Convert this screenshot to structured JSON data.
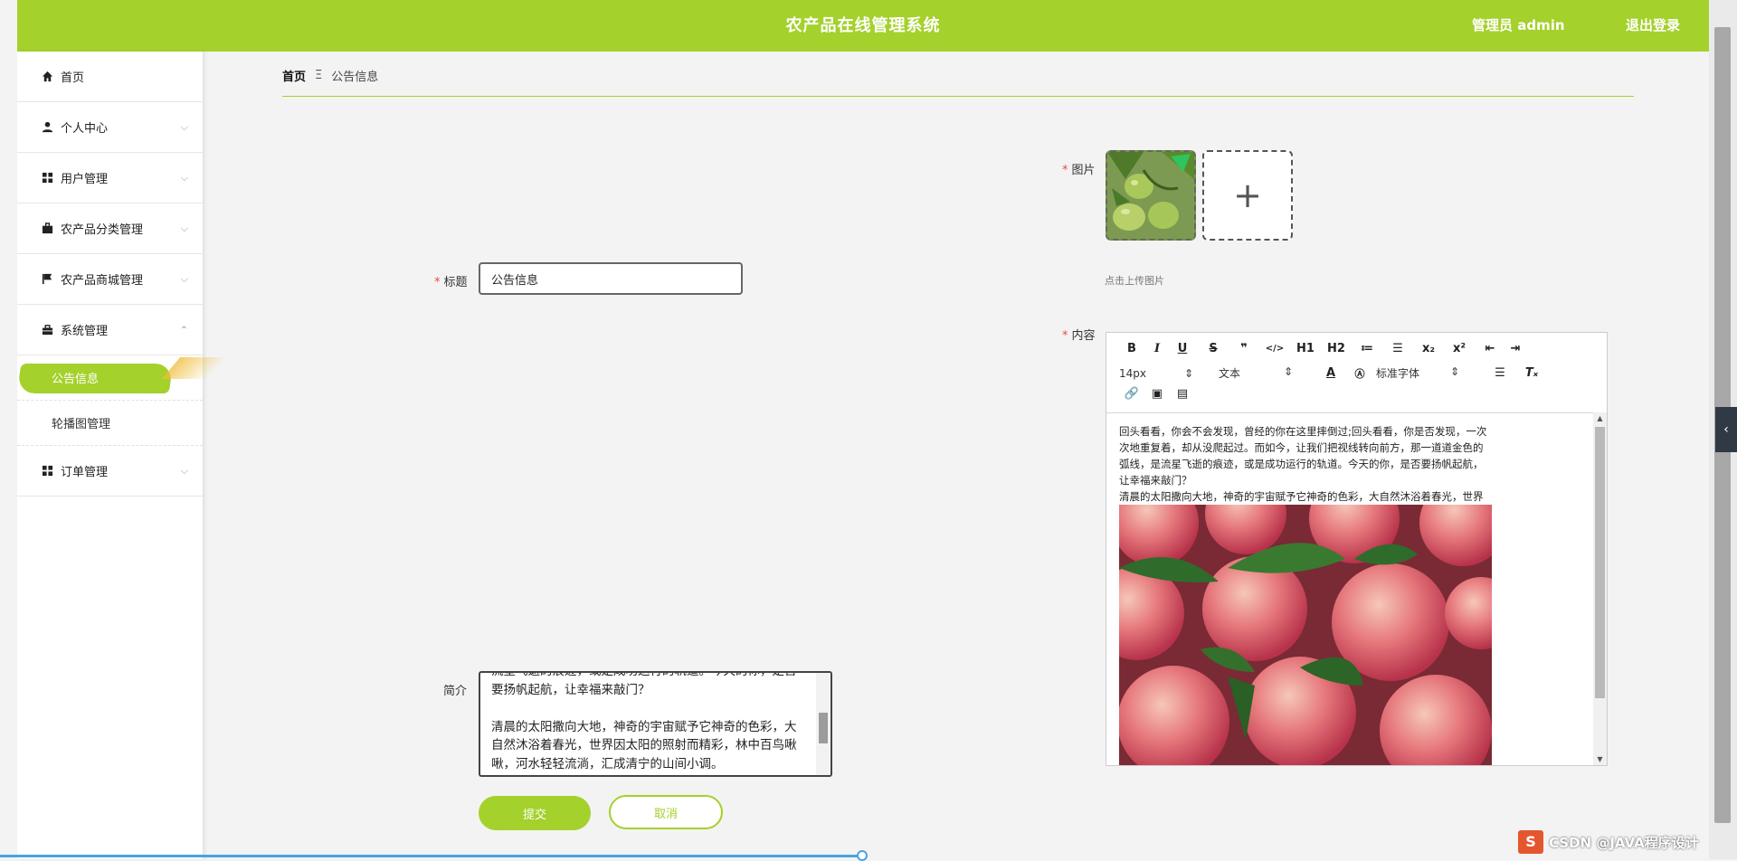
{
  "header": {
    "title": "农产品在线管理系统",
    "user": "管理员 admin",
    "logout": "退出登录",
    "accent": "#a4d12b"
  },
  "sidebar": {
    "items": [
      {
        "label": "首页",
        "icon": "home-icon"
      },
      {
        "label": "个人中心",
        "icon": "user-icon"
      },
      {
        "label": "用户管理",
        "icon": "grid-icon"
      },
      {
        "label": "农产品分类管理",
        "icon": "briefcase-icon"
      },
      {
        "label": "农产品商城管理",
        "icon": "flag-icon"
      },
      {
        "label": "系统管理",
        "icon": "toolbox-icon"
      },
      {
        "label": "订单管理",
        "icon": "grid-icon"
      }
    ],
    "system_sub": [
      {
        "label": "公告信息",
        "active": true
      },
      {
        "label": "轮播图管理",
        "active": false
      }
    ]
  },
  "breadcrumb": {
    "home": "首页",
    "separator": "Ξ",
    "current": "公告信息"
  },
  "form": {
    "title_label": "标题",
    "title_value": "公告信息",
    "image_label": "图片",
    "upload_hint": "点击上传图片",
    "content_label": "内容",
    "summary_label": "简介",
    "summary_text": "流星飞逝的痕迹，或是成功运行的轨道。今天的你，是否要扬帆起航，让幸福来敲门？\n\n清晨的太阳撒向大地，神奇的宇宙赋予它神奇的色彩，大自然沐浴着春光，世界因太阳的照射而精彩，林中百鸟啾啾，河水轻轻流淌，汇成清宁的山间小调。",
    "submit": "提交",
    "cancel": "取消"
  },
  "editor": {
    "toolbar_row1": [
      "B",
      "I",
      "U",
      "S",
      "❞",
      "</>",
      "H1",
      "H2",
      "≔",
      "☰",
      "x₂",
      "x²",
      "⇤",
      "⇥"
    ],
    "font_size": "14px",
    "block_type": "文本",
    "font_family": "标准字体",
    "content_p1": "回头看看，你会不会发现，曾经的你在这里摔倒过;回头看看，你是否发现，一次次地重复着，却从没爬起过。而如今，让我们把视线转向前方，那一道道金色的弧线，是流星飞逝的痕迹，或是成功运行的轨道。今天的你，是否要扬帆起航，让幸福来敲门？",
    "content_p2": "清晨的太阳撒向大地，神奇的宇宙赋予它神奇的色彩，大自然沐浴着春光，世界因太阳的照射而精彩，林中百鸟啾啾，河水轻轻流淌，汇成清宁的山间小调。"
  },
  "watermark": {
    "badge": "S",
    "text": "CSDN @JAVA程序设计"
  }
}
